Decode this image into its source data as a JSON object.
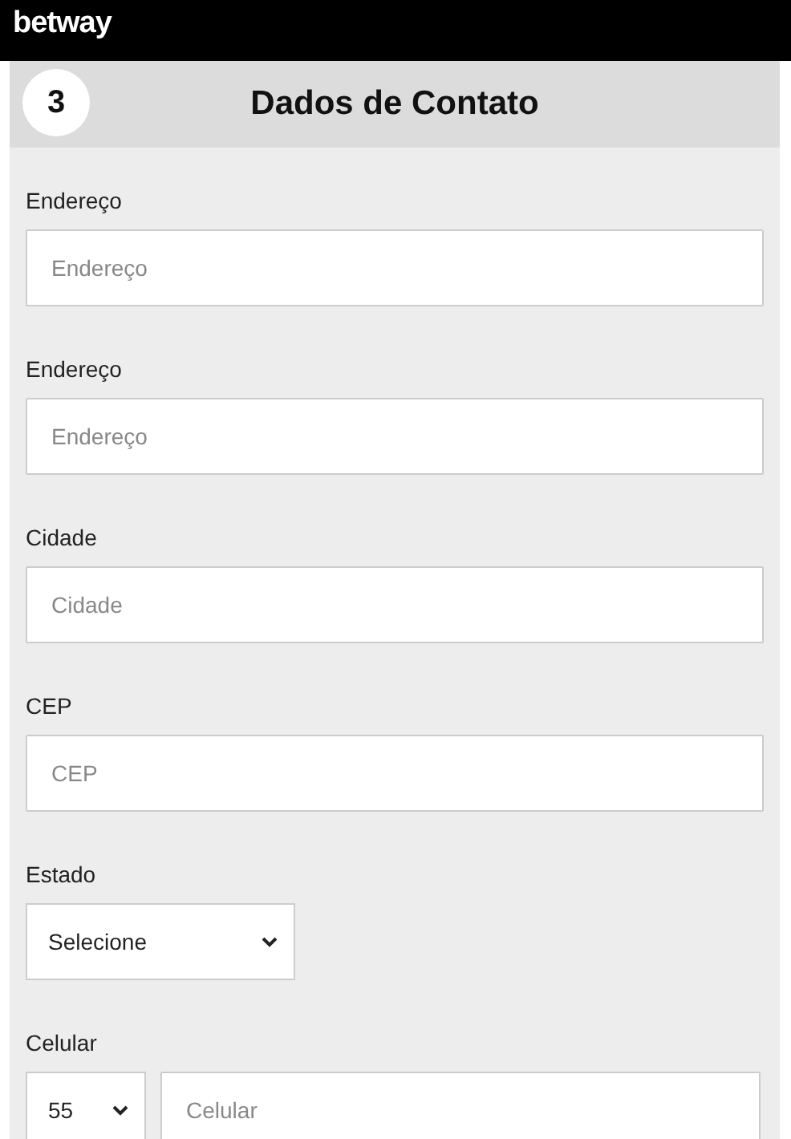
{
  "header": {
    "logo": "betway"
  },
  "section": {
    "step": "3",
    "title": "Dados de Contato"
  },
  "fields": [
    {
      "kind": "text",
      "label": "Endereço",
      "placeholder": "Endereço"
    },
    {
      "kind": "text",
      "label": "Endereço",
      "placeholder": "Endereço"
    },
    {
      "kind": "text",
      "label": "Cidade",
      "placeholder": "Cidade"
    },
    {
      "kind": "text",
      "label": "CEP",
      "placeholder": "CEP"
    },
    {
      "kind": "select",
      "label": "Estado",
      "value": "Selecione"
    },
    {
      "kind": "phone",
      "label": "Celular",
      "code": "55",
      "placeholder": "Celular"
    }
  ]
}
